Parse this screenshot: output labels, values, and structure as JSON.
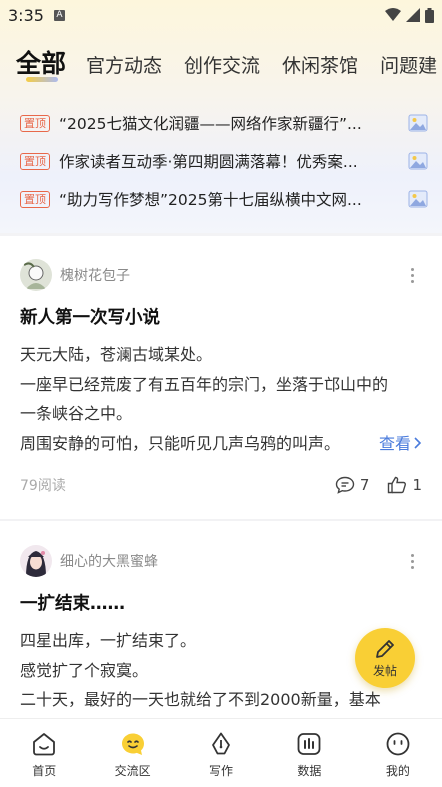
{
  "status_bar": {
    "time": "3:35",
    "notification_icon": "A"
  },
  "tabs": [
    {
      "label": "全部",
      "active": true
    },
    {
      "label": "官方动态",
      "active": false
    },
    {
      "label": "创作交流",
      "active": false
    },
    {
      "label": "休闲茶馆",
      "active": false
    },
    {
      "label": "问题建",
      "active": false
    }
  ],
  "pinned": {
    "badge": "置顶",
    "items": [
      {
        "title": "“2025七猫文化润疆——网络作家新疆行”..."
      },
      {
        "title": "作家读者互动季·第四期圆满落幕！优秀案..."
      },
      {
        "title": "“助力写作梦想”2025第十七届纵横中文网..."
      }
    ]
  },
  "posts": [
    {
      "author": "槐树花包子",
      "title": "新人第一次写小说",
      "lines": [
        "天元大陆，苍澜古域某处。",
        "一座早已经荒废了有五百年的宗门，坐落于邙山中的",
        "一条峡谷之中。",
        "周围安静的可怕，只能听见几声乌鸦的叫声。"
      ],
      "see_more": "查看",
      "read_count": "79阅读",
      "comments": "7",
      "likes": "1"
    },
    {
      "author": "细心的大黑蜜蜂",
      "title": "一扩结束……",
      "lines": [
        "四星出库，一扩结束了。",
        "感觉扩了个寂寞。",
        "二十天，最好的一天也就给了不到2000新量，基本"
      ]
    }
  ],
  "fab": {
    "label": "发帖"
  },
  "bottom_nav": [
    {
      "label": "首页",
      "icon": "home-face-icon"
    },
    {
      "label": "交流区",
      "icon": "community-face-icon",
      "active": true
    },
    {
      "label": "写作",
      "icon": "pen-nib-icon"
    },
    {
      "label": "数据",
      "icon": "bar-chart-icon"
    },
    {
      "label": "我的",
      "icon": "profile-face-icon"
    }
  ],
  "colors": {
    "accent_yellow": "#f9cf35",
    "pin_red": "#e8684a",
    "link_blue": "#4a7bdc"
  }
}
